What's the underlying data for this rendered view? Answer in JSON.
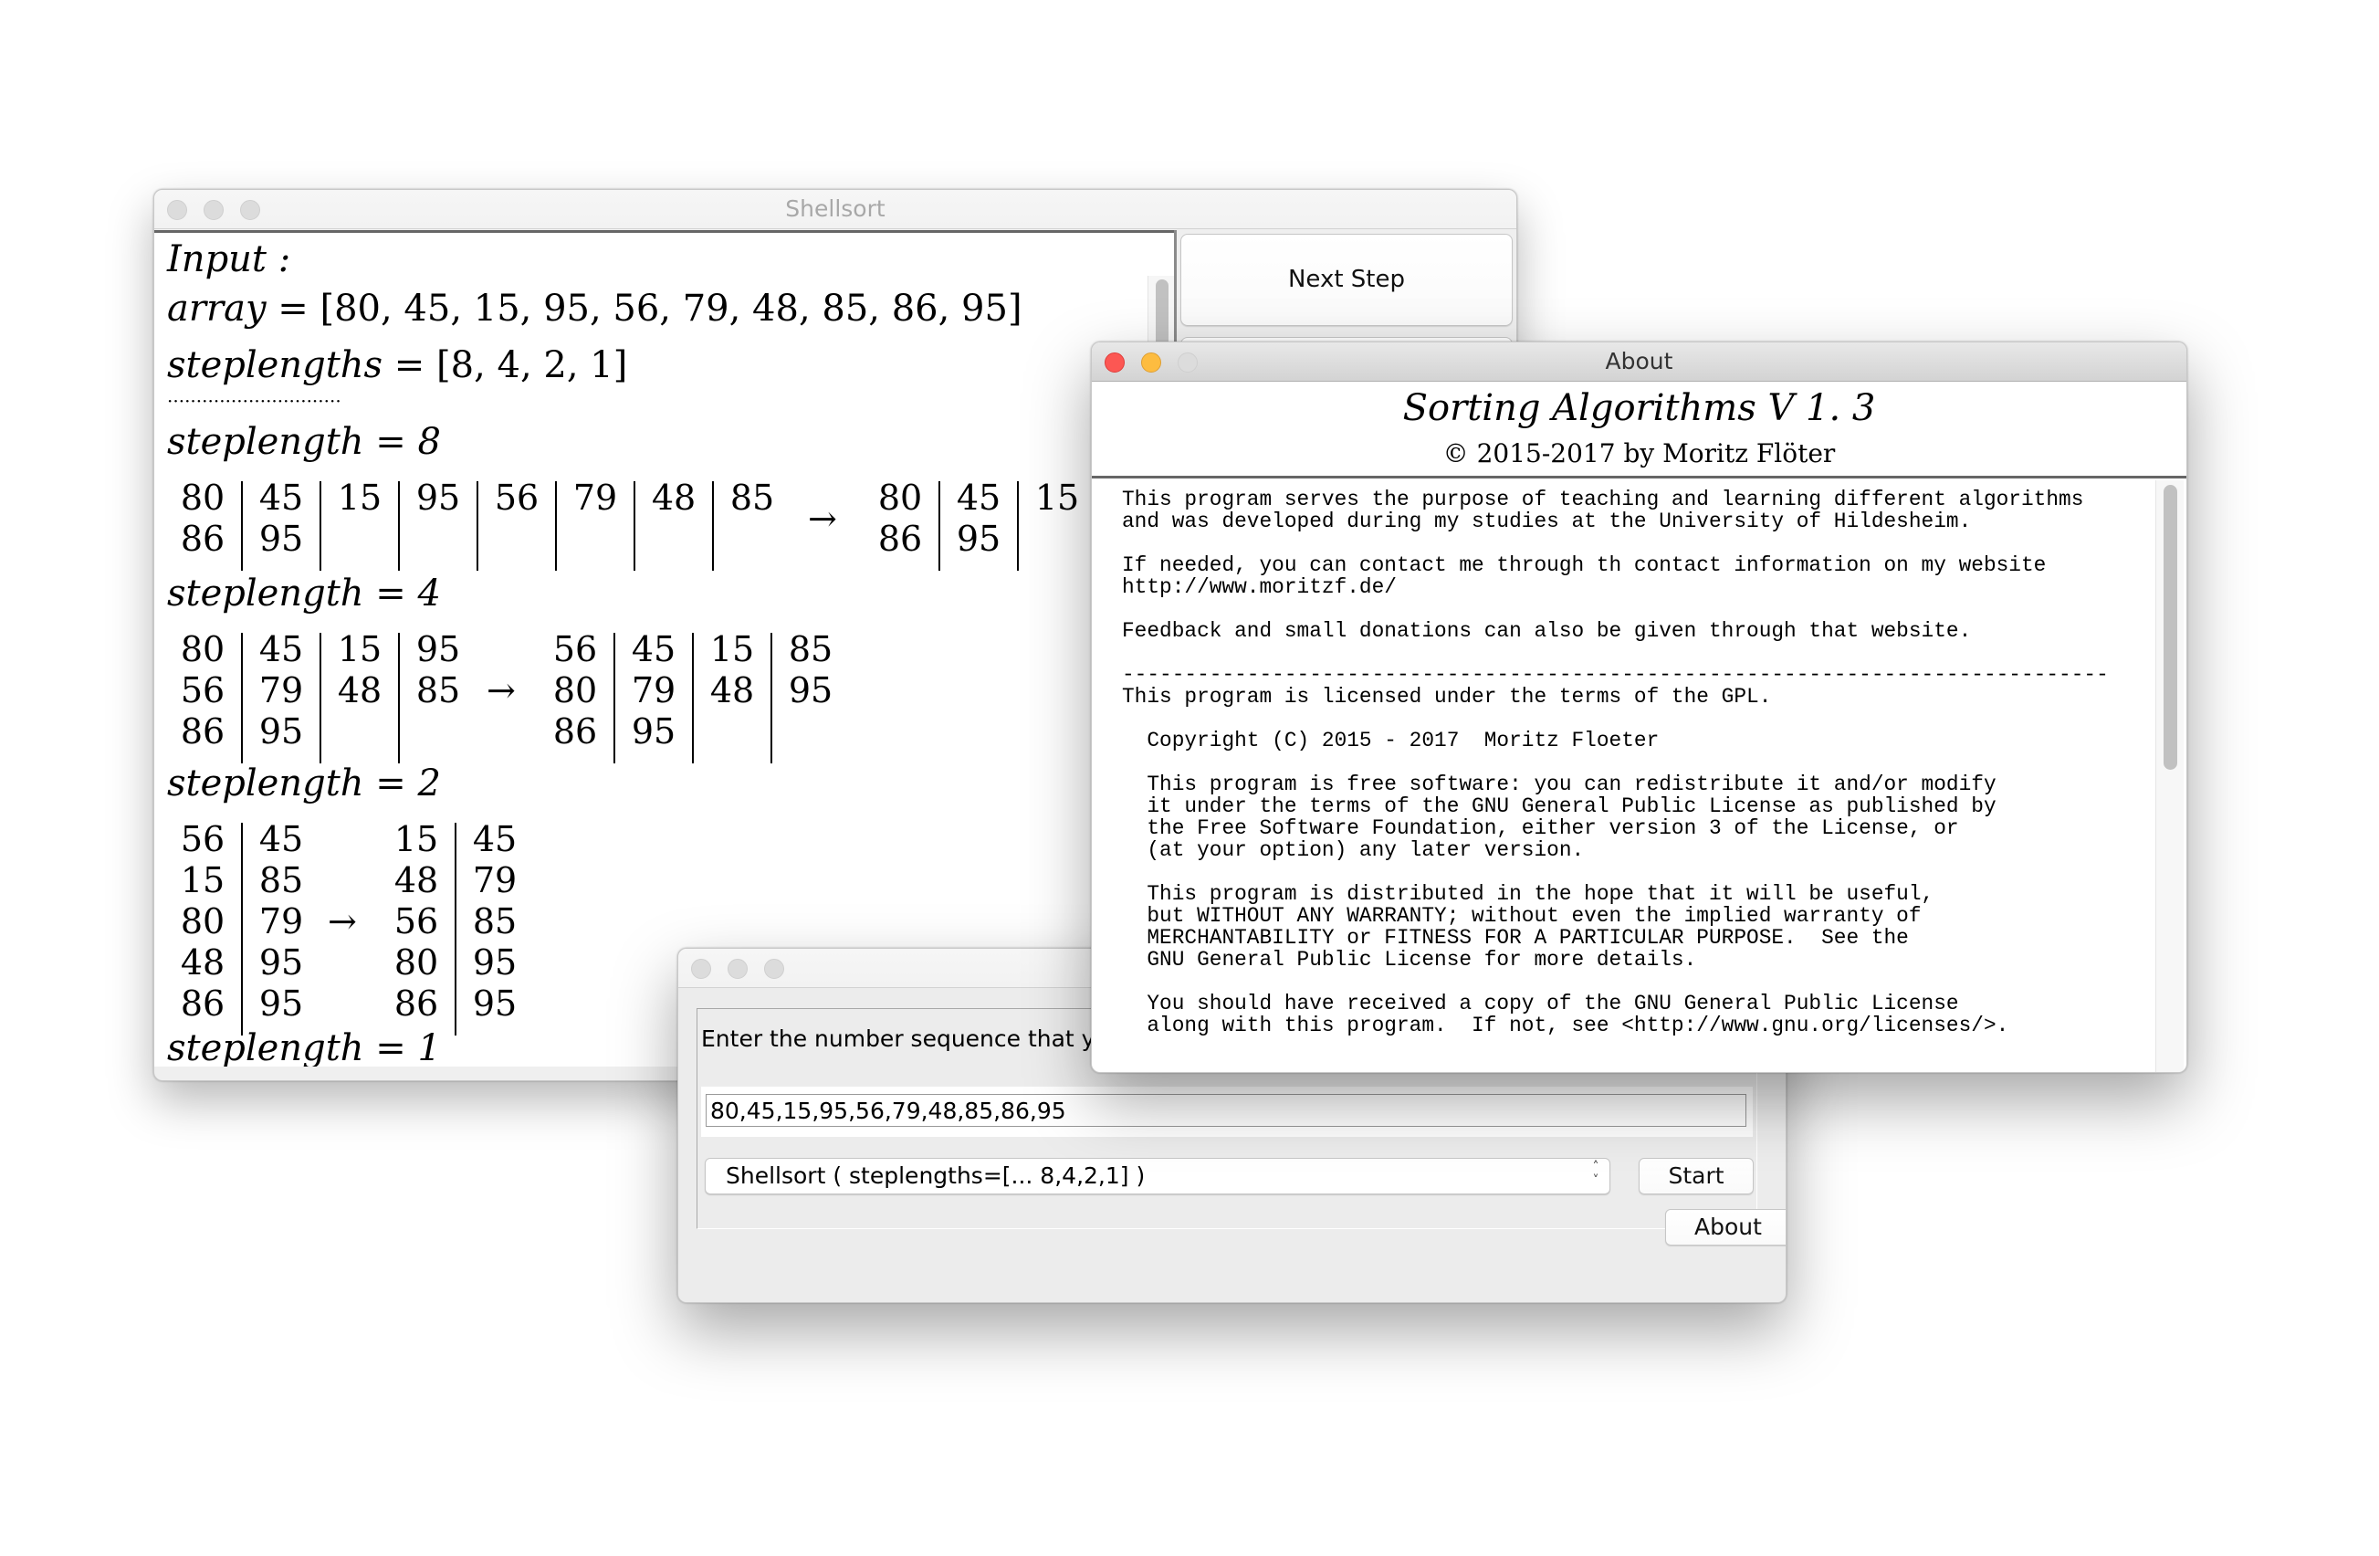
{
  "windows": {
    "shellsort": {
      "title": "Shellsort",
      "next_step_label": "Next Step",
      "content": {
        "input_label": "Input :",
        "array_label": "array = ",
        "array_value": "[80, 45, 15, 95, 56, 79, 48, 85, 86, 95]",
        "steplengths_label": "steplengths = ",
        "steplengths_value": "[8, 4, 2, 1]",
        "separator": "······························",
        "arrow": "→",
        "steps": [
          {
            "label": "steplength = 8",
            "before": [
              [
                "80",
                "86"
              ],
              [
                "45",
                "95"
              ],
              [
                "15"
              ],
              [
                "95"
              ],
              [
                "56"
              ],
              [
                "79"
              ],
              [
                "48"
              ],
              [
                "85"
              ]
            ],
            "after_visible": [
              [
                "80",
                "86"
              ],
              [
                "45",
                "95"
              ],
              [
                "15"
              ]
            ]
          },
          {
            "label": "steplength = 4",
            "before": [
              [
                "80",
                "56",
                "86"
              ],
              [
                "45",
                "79",
                "95"
              ],
              [
                "15",
                "48"
              ],
              [
                "95",
                "85"
              ]
            ],
            "after": [
              [
                "56",
                "80",
                "86"
              ],
              [
                "45",
                "79",
                "95"
              ],
              [
                "15",
                "48"
              ],
              [
                "85",
                "95"
              ]
            ]
          },
          {
            "label": "steplength = 2",
            "before": [
              [
                "56",
                "15",
                "80",
                "48",
                "86"
              ],
              [
                "45",
                "85",
                "79",
                "95",
                "95"
              ]
            ],
            "after": [
              [
                "15",
                "48",
                "56",
                "80",
                "86"
              ],
              [
                "45",
                "79",
                "85",
                "95",
                "95"
              ]
            ]
          },
          {
            "label": "steplength = 1"
          }
        ]
      }
    },
    "about": {
      "title": "About",
      "app_title": "Sorting Algorithms V 1. 3",
      "copyright": "© 2015-2017 by Moritz Flöter",
      "text_lines": [
        "This program serves the purpose of teaching and learning different algorithms",
        "and was developed during my studies at the University of Hildesheim.",
        "",
        "If needed, you can contact me through th contact information on my website",
        "http://www.moritzf.de/",
        "",
        "Feedback and small donations can also be given through that website.",
        "",
        "-------------------------------------------------------------------------------",
        "This program is licensed under the terms of the GPL.",
        "",
        "  Copyright (C) 2015 - 2017  Moritz Floeter",
        "",
        "  This program is free software: you can redistribute it and/or modify",
        "  it under the terms of the GNU General Public License as published by",
        "  the Free Software Foundation, either version 3 of the License, or",
        "  (at your option) any later version.",
        "",
        "  This program is distributed in the hope that it will be useful,",
        "  but WITHOUT ANY WARRANTY; without even the implied warranty of",
        "  MERCHANTABILITY or FITNESS FOR A PARTICULAR PURPOSE.  See the",
        "  GNU General Public License for more details.",
        "",
        "  You should have received a copy of the GNU General Public License",
        "  along with this program.  If not, see <http://www.gnu.org/licenses/>."
      ]
    },
    "input": {
      "title": "",
      "prompt": "Enter the number sequence that yo",
      "sequence_value": "80,45,15,95,56,79,48,85,86,95",
      "algorithm_selected": "Shellsort ( steplengths=[... 8,4,2,1] )",
      "start_label": "Start",
      "about_label": "About"
    }
  },
  "colors": {
    "close": "#fc5753",
    "minimize": "#fdbc40",
    "inactive_light": "#dcdcdc"
  }
}
